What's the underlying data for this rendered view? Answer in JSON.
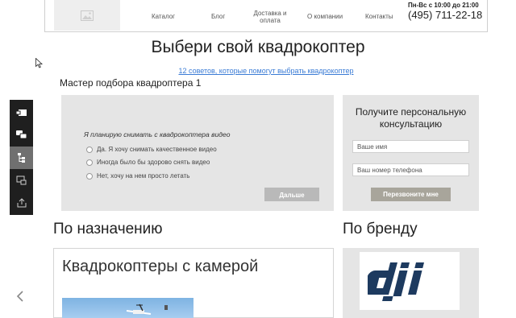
{
  "header": {
    "nav": [
      {
        "label": "Каталог"
      },
      {
        "label": "Блог"
      },
      {
        "label": "Доставка и\nоплата"
      },
      {
        "label": "О компании"
      },
      {
        "label": "Контакты"
      }
    ],
    "hours": "Пн-Вс с 10:00 до 21:00",
    "phone": "(495) 711-22-18"
  },
  "main": {
    "title": "Выбери свой квадрокоптер",
    "tips_link": "12 советов, которые помогут выбрать квадрокоптер",
    "master_title": "Мастер подбора квадроптера  1"
  },
  "wizard": {
    "question": "Я планирую снимать с квадрокоптера видео",
    "options": [
      "Да. Я хочу снимать качественное видео",
      "Иногда было бы здорово снять видео",
      "Нет, хочу на нем просто летать"
    ],
    "next_label": "Дальше"
  },
  "consult": {
    "title": "Получите персональную консультацию",
    "name_placeholder": "Ваше имя",
    "phone_placeholder": "Ваш номер телефона",
    "call_label": "Перезвоните мне"
  },
  "sections": {
    "purpose": "По назначению",
    "brand": "По бренду",
    "camera_card": "Квадрокоптеры с камерой"
  },
  "brand_logo": {
    "text": "dji"
  },
  "toolbar": {
    "icons": [
      "screen-share-icon",
      "chat-icon",
      "tree-icon",
      "video-icon",
      "export-icon"
    ]
  },
  "colors": {
    "link": "#3a7bd5",
    "panel": "#e5e5e5",
    "toolbar": "#1f1f1f",
    "dji_navy": "#1d3a5f"
  }
}
